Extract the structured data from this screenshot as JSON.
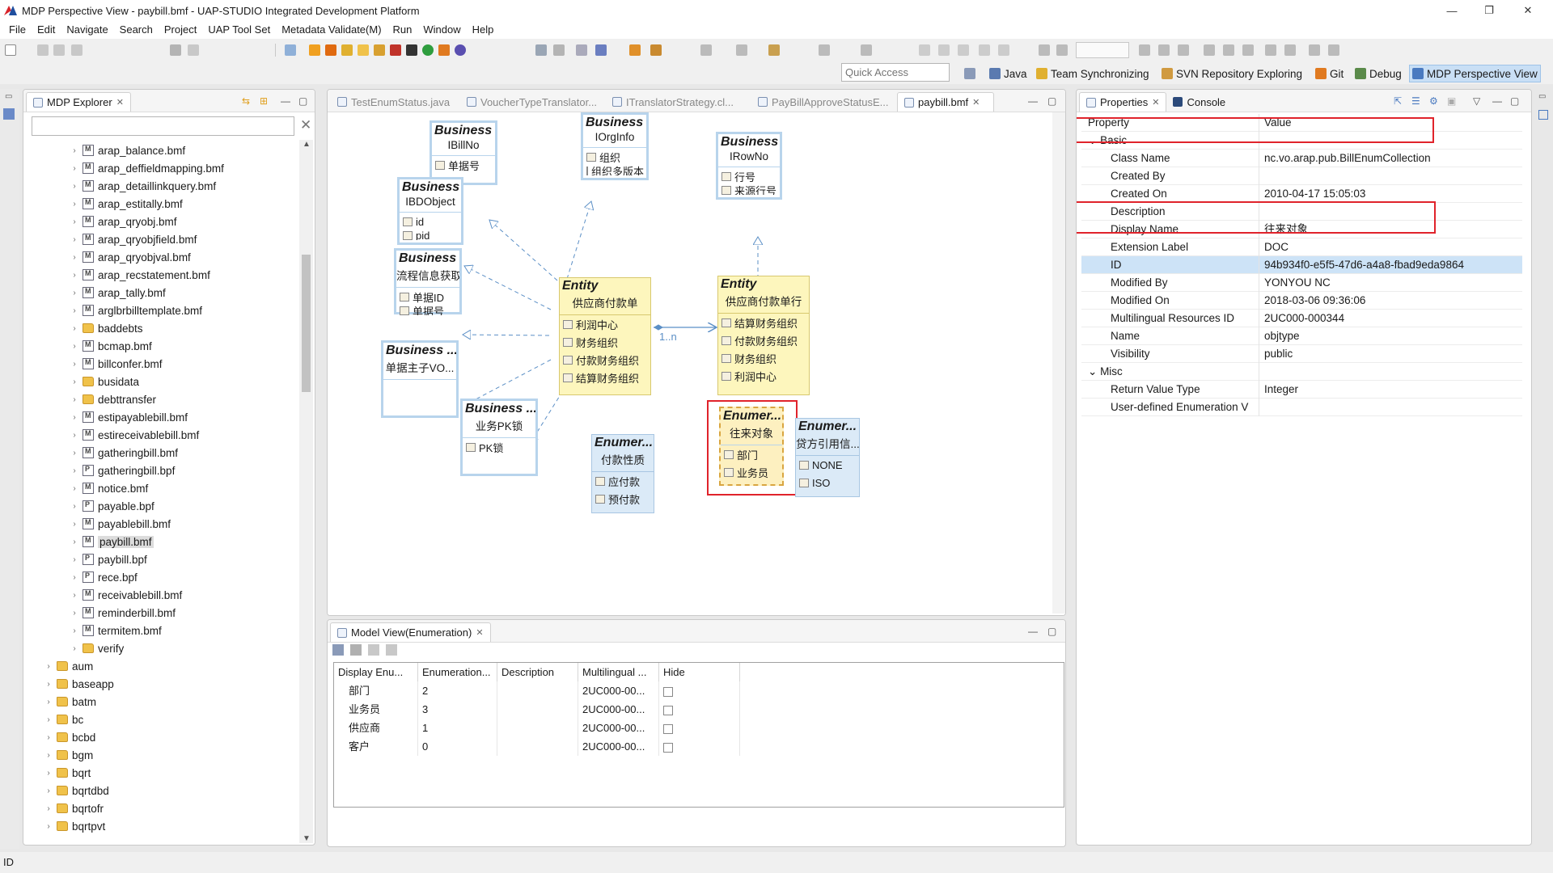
{
  "window": {
    "title": "MDP Perspective View - paybill.bmf - UAP-STUDIO Integrated Development Platform",
    "minimize": "—",
    "restore": "❐",
    "close": "✕"
  },
  "menu": [
    "File",
    "Edit",
    "Navigate",
    "Search",
    "Project",
    "UAP Tool Set",
    "Metadata Validate(M)",
    "Run",
    "Window",
    "Help"
  ],
  "quick_access": {
    "placeholder": "Quick Access"
  },
  "perspectives": [
    {
      "label": "Java",
      "icon": "java-perspective-icon"
    },
    {
      "label": "Team Synchronizing",
      "icon": "team-sync-icon"
    },
    {
      "label": "SVN Repository Exploring",
      "icon": "svn-icon"
    },
    {
      "label": "Git",
      "icon": "git-icon"
    },
    {
      "label": "Debug",
      "icon": "debug-icon"
    },
    {
      "label": "MDP Perspective View",
      "icon": "mdp-perspective-icon",
      "active": true
    }
  ],
  "explorer": {
    "tab_label": "MDP Explorer",
    "clear_glyph": "✕",
    "items": [
      {
        "label": "arap_balance.bmf",
        "type": "file",
        "level": 2
      },
      {
        "label": "arap_deffieldmapping.bmf",
        "type": "file",
        "level": 2
      },
      {
        "label": "arap_detaillinkquery.bmf",
        "type": "file",
        "level": 2
      },
      {
        "label": "arap_estitally.bmf",
        "type": "file",
        "level": 2
      },
      {
        "label": "arap_qryobj.bmf",
        "type": "file",
        "level": 2
      },
      {
        "label": "arap_qryobjfield.bmf",
        "type": "file",
        "level": 2
      },
      {
        "label": "arap_qryobjval.bmf",
        "type": "file",
        "level": 2
      },
      {
        "label": "arap_recstatement.bmf",
        "type": "file",
        "level": 2
      },
      {
        "label": "arap_tally.bmf",
        "type": "file",
        "level": 2
      },
      {
        "label": "arglbrbilltemplate.bmf",
        "type": "file",
        "level": 2
      },
      {
        "label": "baddebts",
        "type": "folder",
        "level": 2
      },
      {
        "label": "bcmap.bmf",
        "type": "file",
        "level": 2
      },
      {
        "label": "billconfer.bmf",
        "type": "file",
        "level": 2
      },
      {
        "label": "busidata",
        "type": "folder",
        "level": 2
      },
      {
        "label": "debttransfer",
        "type": "folder",
        "level": 2
      },
      {
        "label": "estipayablebill.bmf",
        "type": "file",
        "level": 2
      },
      {
        "label": "estireceivablebill.bmf",
        "type": "file",
        "level": 2
      },
      {
        "label": "gatheringbill.bmf",
        "type": "file",
        "level": 2
      },
      {
        "label": "gatheringbill.bpf",
        "type": "bpf",
        "level": 2
      },
      {
        "label": "notice.bmf",
        "type": "file",
        "level": 2
      },
      {
        "label": "payable.bpf",
        "type": "bpf",
        "level": 2
      },
      {
        "label": "payablebill.bmf",
        "type": "file",
        "level": 2
      },
      {
        "label": "paybill.bmf",
        "type": "file",
        "level": 2,
        "selected": true
      },
      {
        "label": "paybill.bpf",
        "type": "bpf",
        "level": 2
      },
      {
        "label": "rece.bpf",
        "type": "bpf",
        "level": 2
      },
      {
        "label": "receivablebill.bmf",
        "type": "file",
        "level": 2
      },
      {
        "label": "reminderbill.bmf",
        "type": "file",
        "level": 2
      },
      {
        "label": "termitem.bmf",
        "type": "file",
        "level": 2
      },
      {
        "label": "verify",
        "type": "folder",
        "level": 2
      },
      {
        "label": "aum",
        "type": "folder",
        "level": 1
      },
      {
        "label": "baseapp",
        "type": "folder",
        "level": 1
      },
      {
        "label": "batm",
        "type": "folder",
        "level": 1
      },
      {
        "label": "bc",
        "type": "folder",
        "level": 1
      },
      {
        "label": "bcbd",
        "type": "folder",
        "level": 1
      },
      {
        "label": "bgm",
        "type": "folder",
        "level": 1
      },
      {
        "label": "bqrt",
        "type": "folder",
        "level": 1
      },
      {
        "label": "bqrtdbd",
        "type": "folder",
        "level": 1
      },
      {
        "label": "bqrtofr",
        "type": "folder",
        "level": 1
      },
      {
        "label": "bqrtpvt",
        "type": "folder",
        "level": 1
      }
    ]
  },
  "editor": {
    "tabs": [
      {
        "label": "TestEnumStatus.java",
        "active": false
      },
      {
        "label": "VoucherTypeTranslator...",
        "active": false
      },
      {
        "label": "ITranslatorStrategy.cl...",
        "active": false
      },
      {
        "label": "PayBillApproveStatusE...",
        "active": false
      },
      {
        "label": "paybill.bmf",
        "active": true
      }
    ],
    "multiplicity": "1..n",
    "boxes": {
      "ibillno": {
        "header": "Business ...",
        "name": "IBillNo",
        "attrs": [
          "单据号"
        ]
      },
      "iorginfo": {
        "header": "Business ...",
        "name": "IOrgInfo",
        "attrs": [
          "组织",
          "组织多版本"
        ]
      },
      "irowno": {
        "header": "Business ...",
        "name": "IRowNo",
        "attrs": [
          "行号",
          "来源行号"
        ]
      },
      "ibdobject": {
        "header": "Business ...",
        "name": "IBDObject",
        "attrs": [
          "id",
          "pid"
        ]
      },
      "flow": {
        "header": "Business ...",
        "name": "流程信息获取...",
        "attrs": [
          "单据ID",
          "单据号"
        ]
      },
      "mainvo": {
        "header": "Business ...",
        "name": "单据主子VO...",
        "attrs": []
      },
      "pklock": {
        "header": "Business ...",
        "name": "业务PK锁",
        "attrs": [
          "PK锁"
        ]
      },
      "entity_main": {
        "header": "Entity",
        "name": "供应商付款单",
        "attrs": [
          "利润中心",
          "财务组织",
          "付款财务组织",
          "结算财务组织"
        ]
      },
      "entity_row": {
        "header": "Entity",
        "name": "供应商付款单行",
        "attrs": [
          "结算财务组织",
          "付款财务组织",
          "财务组织",
          "利润中心"
        ]
      },
      "enum_nature": {
        "header": "Enumer...",
        "name": "付款性质",
        "attrs": [
          "应付款",
          "预付款"
        ]
      },
      "enum_party": {
        "header": "Enumer...",
        "name": "往来对象",
        "attrs": [
          "部门",
          "业务员"
        ]
      },
      "enum_credit": {
        "header": "Enumer...",
        "name": "贷方引用信...",
        "attrs": [
          "NONE",
          "ISO"
        ]
      }
    }
  },
  "model_view": {
    "tab_label": "Model View(Enumeration)",
    "columns": [
      "Display Enu...",
      "Enumeration...",
      "Description",
      "Multilingual ...",
      "Hide"
    ],
    "rows": [
      {
        "display": "部门",
        "value": "2",
        "description": "",
        "multilingual": "2UC000-00...",
        "hide": false
      },
      {
        "display": "业务员",
        "value": "3",
        "description": "",
        "multilingual": "2UC000-00...",
        "hide": false
      },
      {
        "display": "供应商",
        "value": "1",
        "description": "",
        "multilingual": "2UC000-00...",
        "hide": false
      },
      {
        "display": "客户",
        "value": "0",
        "description": "",
        "multilingual": "2UC000-00...",
        "hide": false
      }
    ]
  },
  "properties": {
    "tab_label": "Properties",
    "console_label": "Console",
    "col_property": "Property",
    "col_value": "Value",
    "groups": [
      {
        "name": "Basic",
        "rows": [
          {
            "key": "Class Name",
            "value": "nc.vo.arap.pub.BillEnumCollection"
          },
          {
            "key": "Created By",
            "value": ""
          },
          {
            "key": "Created On",
            "value": "2010-04-17 15:05:03"
          },
          {
            "key": "Description",
            "value": ""
          },
          {
            "key": "Display Name",
            "value": "往来对象"
          },
          {
            "key": "Extension Label",
            "value": "DOC"
          },
          {
            "key": "ID",
            "value": "94b934f0-e5f5-47d6-a4a8-fbad9eda9864",
            "selected": true
          },
          {
            "key": "Modified By",
            "value": "YONYOU NC"
          },
          {
            "key": "Modified On",
            "value": "2018-03-06 09:36:06"
          },
          {
            "key": "Multilingual Resources ID",
            "value": "2UC000-000344"
          },
          {
            "key": "Name",
            "value": "objtype"
          },
          {
            "key": "Visibility",
            "value": "public"
          }
        ]
      },
      {
        "name": "Misc",
        "rows": [
          {
            "key": "Return Value Type",
            "value": "Integer"
          },
          {
            "key": "User-defined Enumeration V",
            "value": ""
          }
        ]
      }
    ]
  },
  "statusbar": {
    "text": "ID"
  },
  "colors": {
    "highlight_red": "#e0232b",
    "entity_fill": "#fdf6bd",
    "interface_border": "#b8d4ec",
    "enum_fill": "#dbeaf7",
    "selection_blue": "#cde3f7",
    "link_blue": "#5b8fc6"
  }
}
